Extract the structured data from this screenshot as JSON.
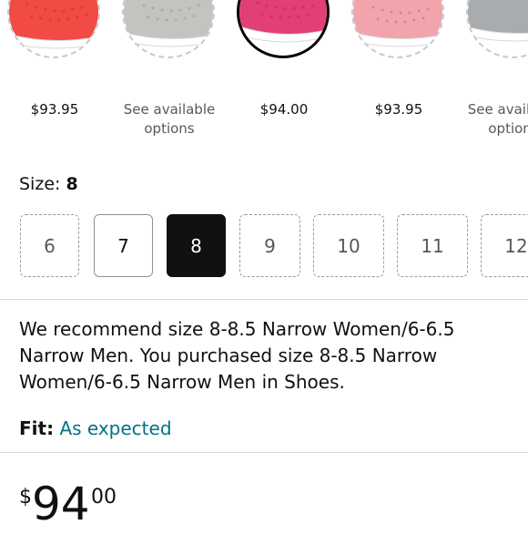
{
  "colors": {
    "text": "#0f1111",
    "secondary_text": "#565959",
    "link": "#007185",
    "selected_size_bg": "#111111"
  },
  "swatches": [
    {
      "product_color": "coral red",
      "price": "$93.95",
      "selected": false,
      "available": false
    },
    {
      "product_color": "light gray",
      "price_note": "See available options",
      "selected": false,
      "available": true
    },
    {
      "product_color": "hot pink",
      "price": "$94.00",
      "selected": true,
      "available": true
    },
    {
      "product_color": "light pink",
      "price": "$93.95",
      "selected": false,
      "available": false
    },
    {
      "product_color": "gray",
      "price_note": "See available options",
      "selected": false,
      "available": true
    }
  ],
  "size": {
    "label": "Size:",
    "selected_value": "8",
    "options": [
      {
        "label": "6",
        "state": "unavailable"
      },
      {
        "label": "7",
        "state": "available"
      },
      {
        "label": "8",
        "state": "selected"
      },
      {
        "label": "9",
        "state": "unavailable"
      },
      {
        "label": "10",
        "state": "unavailable"
      },
      {
        "label": "11",
        "state": "unavailable"
      },
      {
        "label": "12",
        "state": "unavailable"
      }
    ]
  },
  "recommendation": {
    "text": "We recommend size 8-8.5 Narrow Women/6-6.5 Narrow Men. You purchased size 8-8.5 Narrow Women/6-6.5 Narrow Men in Shoes."
  },
  "fit": {
    "label": "Fit:",
    "value": "As expected"
  },
  "price": {
    "symbol": "$",
    "whole": "94",
    "fraction": "00"
  }
}
